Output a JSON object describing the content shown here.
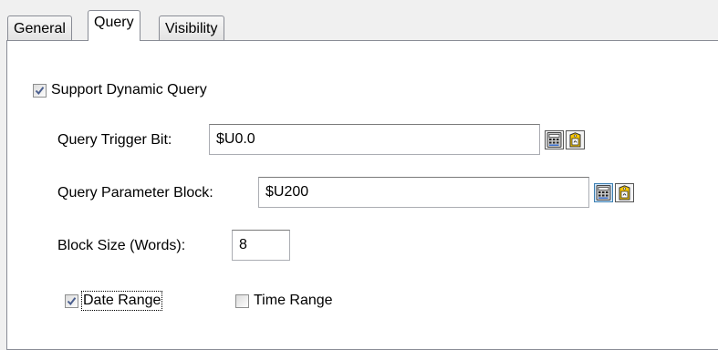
{
  "tabs": {
    "general": "General",
    "query": "Query",
    "visibility": "Visibility"
  },
  "support_dynamic_query": {
    "label": "Support Dynamic Query",
    "checked": true
  },
  "query_trigger_bit": {
    "label": "Query Trigger Bit:",
    "value": "$U0.0"
  },
  "query_parameter_block": {
    "label": "Query Parameter Block:",
    "value": "$U200"
  },
  "block_size": {
    "label": "Block Size (Words):",
    "value": "8"
  },
  "date_range": {
    "label": "Date Range",
    "checked": true
  },
  "time_range": {
    "label": "Time Range",
    "checked": false
  },
  "icons": {
    "calculator": "calculator-icon",
    "tag_browse": "tag-browse-icon"
  },
  "colors": {
    "check": "#4b5f8f",
    "panel_border": "#898c95",
    "hover_border": "#3c7fb1"
  }
}
